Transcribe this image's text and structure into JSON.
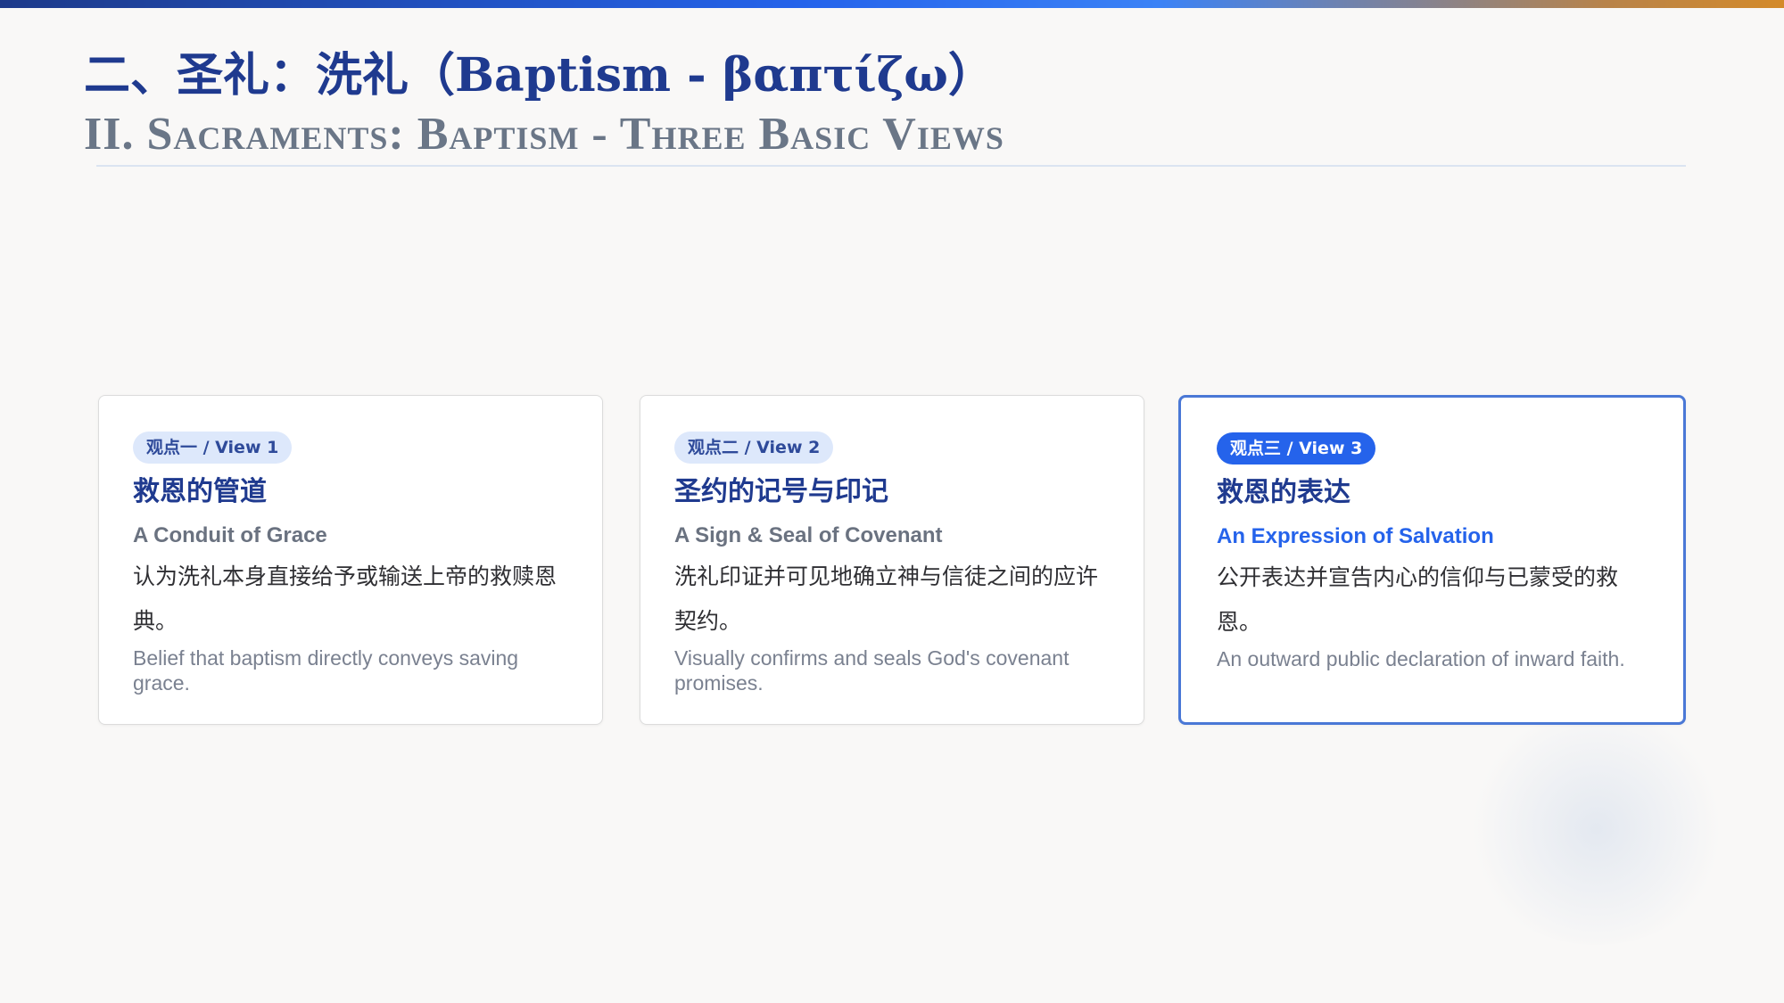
{
  "header": {
    "title_cn": "二、圣礼：洗礼（Baptism - βαπτίζω）",
    "title_en": "II. Sacraments: Baptism - Three Basic Views"
  },
  "cards": [
    {
      "badge": "观点一 / View 1",
      "title_cn": "救恩的管道",
      "title_en": "A Conduit of Grace",
      "desc_cn": "认为洗礼本身直接给予或输送上帝的救赎恩典。",
      "desc_en": "Belief that baptism directly conveys saving grace.",
      "highlighted": false
    },
    {
      "badge": "观点二 / View 2",
      "title_cn": "圣约的记号与印记",
      "title_en": "A Sign & Seal of Covenant",
      "desc_cn": "洗礼印证并可见地确立神与信徒之间的应许契约。",
      "desc_en": "Visually confirms and seals God's covenant promises.",
      "highlighted": false
    },
    {
      "badge": "观点三 / View 3",
      "title_cn": "救恩的表达",
      "title_en": "An Expression of Salvation",
      "desc_cn": "公开表达并宣告内心的信仰与已蒙受的救恩。",
      "desc_en": "An outward public declaration of inward faith.",
      "highlighted": true
    }
  ],
  "colors": {
    "primary": "#1f3a8f",
    "accent": "#2563eb",
    "muted": "#6a7687"
  }
}
